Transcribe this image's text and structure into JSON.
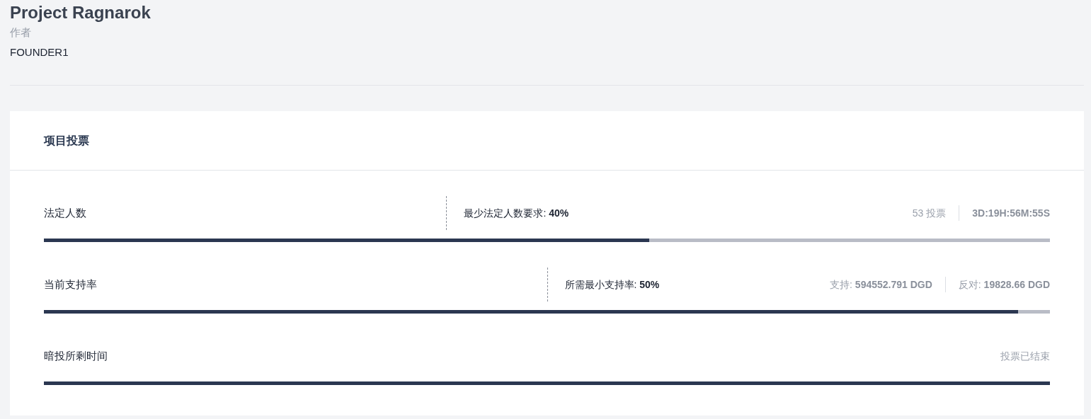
{
  "project": {
    "title": "Project Ragnarok",
    "author_label": "作者",
    "author": "FOUNDER1"
  },
  "voting": {
    "title": "项目投票",
    "rows": [
      {
        "label": "法定人数",
        "threshold": {
          "text": "最少法定人数要求: **40%**",
          "level": 0.4
        },
        "level": 0.602,
        "stats": [
          "53 投票",
          "**3D:19H:56M:55S**"
        ]
      },
      {
        "label": "当前支持率",
        "threshold": {
          "text": "所需最小支持率: **50%**",
          "level": 0.5
        },
        "level": 0.968,
        "stats": [
          "支持: **594552.791 DGD**",
          "反对: **19828.66 DGD**"
        ]
      },
      {
        "label": "暗投所剩时间",
        "stats": [
          "投票已结束"
        ]
      }
    ]
  }
}
